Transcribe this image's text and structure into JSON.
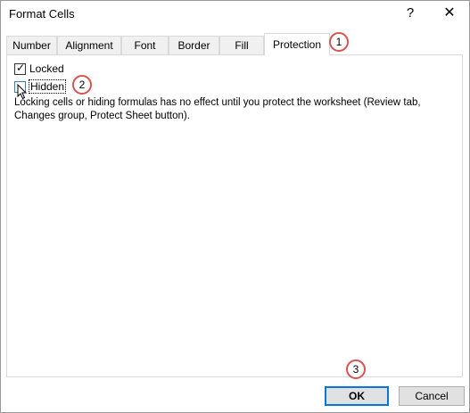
{
  "window": {
    "title": "Format Cells",
    "help_label": "?",
    "close_label": "✕"
  },
  "tabs": [
    {
      "label": "Number"
    },
    {
      "label": "Alignment"
    },
    {
      "label": "Font"
    },
    {
      "label": "Border"
    },
    {
      "label": "Fill"
    },
    {
      "label": "Protection",
      "active": true
    }
  ],
  "protection": {
    "locked_label": "Locked",
    "locked_checked": true,
    "hidden_label": "Hidden",
    "hidden_checked": false,
    "info_text": "Locking cells or hiding formulas has no effect until you protect the worksheet (Review tab, Changes group, Protect Sheet button)."
  },
  "annotations": [
    "1",
    "2",
    "3"
  ],
  "buttons": {
    "ok_label": "OK",
    "cancel_label": "Cancel"
  },
  "colors": {
    "accent": "#0078d7",
    "annotation_ring": "#d9534f"
  }
}
